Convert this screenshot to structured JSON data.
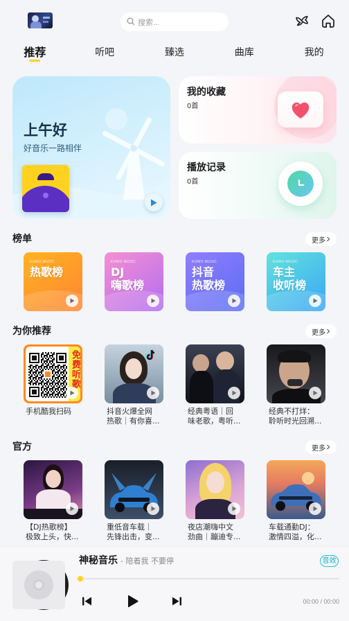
{
  "header": {
    "search_placeholder": "搜索...",
    "avatar_icon": "avatar",
    "right_icons": [
      "bird-icon",
      "home-icon"
    ]
  },
  "tabs": [
    {
      "label": "推荐",
      "active": true
    },
    {
      "label": "听吧",
      "active": false
    },
    {
      "label": "臻选",
      "active": false
    },
    {
      "label": "曲库",
      "active": false
    },
    {
      "label": "我的",
      "active": false
    }
  ],
  "hero": {
    "greeting": "上午好",
    "subtitle": "好音乐一路相伴",
    "action_icon": "play-icon"
  },
  "favorites": {
    "title": "我的收藏",
    "count": "0首",
    "icon": "heart-icon"
  },
  "history": {
    "title": "播放记录",
    "count": "0首",
    "icon": "clock-icon"
  },
  "charts": {
    "title": "榜单",
    "more": "更多",
    "brand": "KUWO MUSIC",
    "items": [
      {
        "lines": [
          "热歌榜"
        ],
        "colors": [
          "#FFB321",
          "#FF8533"
        ]
      },
      {
        "lines": [
          "DJ",
          "嗨歌榜"
        ],
        "colors": [
          "#F590D3",
          "#B36CF0"
        ]
      },
      {
        "lines": [
          "抖音",
          "热歌榜"
        ],
        "colors": [
          "#917DFF",
          "#5B6DF2"
        ]
      },
      {
        "lines": [
          "车主",
          "收听榜"
        ],
        "colors": [
          "#62E3DE",
          "#3AA5F4"
        ]
      }
    ]
  },
  "recommend": {
    "title": "为你推荐",
    "more": "更多",
    "items": [
      {
        "lines": [
          "手机酷我扫码"
        ],
        "badge": "免费听歌"
      },
      {
        "lines": [
          "抖音火爆全网",
          "热歌｜有你喜..."
        ]
      },
      {
        "lines": [
          "经典粤语｜回",
          "味老歌，粤听..."
        ]
      },
      {
        "lines": [
          "经典不打烊：",
          "聆听时光回溯..."
        ]
      }
    ]
  },
  "official": {
    "title": "官方",
    "more": "更多",
    "items": [
      {
        "lines": [
          "【DJ热歌榜】",
          "极致上头，快..."
        ]
      },
      {
        "lines": [
          "重低音车载｜",
          "先锋出击，变..."
        ]
      },
      {
        "lines": [
          "夜店潮嗨中文",
          "劲曲｜蹦迪专..."
        ]
      },
      {
        "lines": [
          "车载通勤DJ：",
          "激情四溢，化..."
        ]
      }
    ]
  },
  "player": {
    "title": "神秘音乐",
    "subtitle": "- 陪着我 不要停",
    "effect": "音效",
    "time": "00:00 / 00:00",
    "progress": 0,
    "controls": [
      "previous-icon",
      "play-icon",
      "next-icon"
    ]
  },
  "accent": "#FFD21F"
}
